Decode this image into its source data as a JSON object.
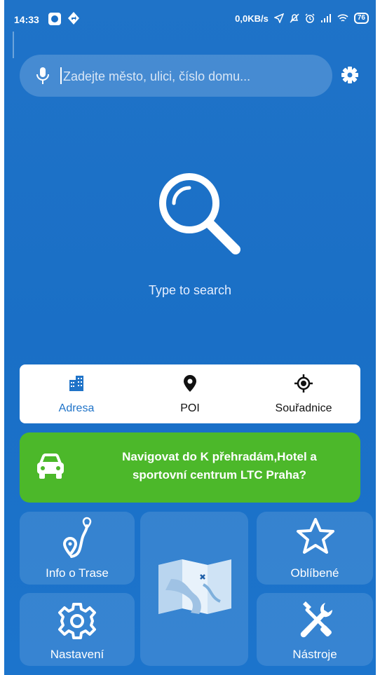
{
  "status_bar": {
    "time": "14:33",
    "net_speed": "0,0KB/s",
    "battery": "76",
    "icons": [
      "app-icon",
      "navigation-app-icon",
      "location-arrow-icon",
      "mute-icon",
      "alarm-icon",
      "signal-icon",
      "wifi-icon",
      "battery-icon"
    ]
  },
  "search": {
    "placeholder": "Zadejte město, ulici, číslo domu...",
    "value": ""
  },
  "center": {
    "hint": "Type to search"
  },
  "tabs": [
    {
      "label": "Adresa",
      "icon": "buildings-icon",
      "active": true
    },
    {
      "label": "POI",
      "icon": "map-pin-icon",
      "active": false
    },
    {
      "label": "Souřadnice",
      "icon": "crosshair-icon",
      "active": false
    }
  ],
  "navigate": {
    "line1": "Navigovat do K přehradám,Hotel a",
    "line2": "sportovní centrum LTC Praha?",
    "icon": "car-icon"
  },
  "tiles": {
    "route_info": "Info o Trase",
    "settings": "Nastavení",
    "favorites": "Oblíbené",
    "tools": "Nástroje",
    "map_icon": "folded-map-icon"
  },
  "colors": {
    "background": "#1f73c8",
    "navigate_green": "#4cb82a",
    "active_tab": "#1f73c8"
  }
}
